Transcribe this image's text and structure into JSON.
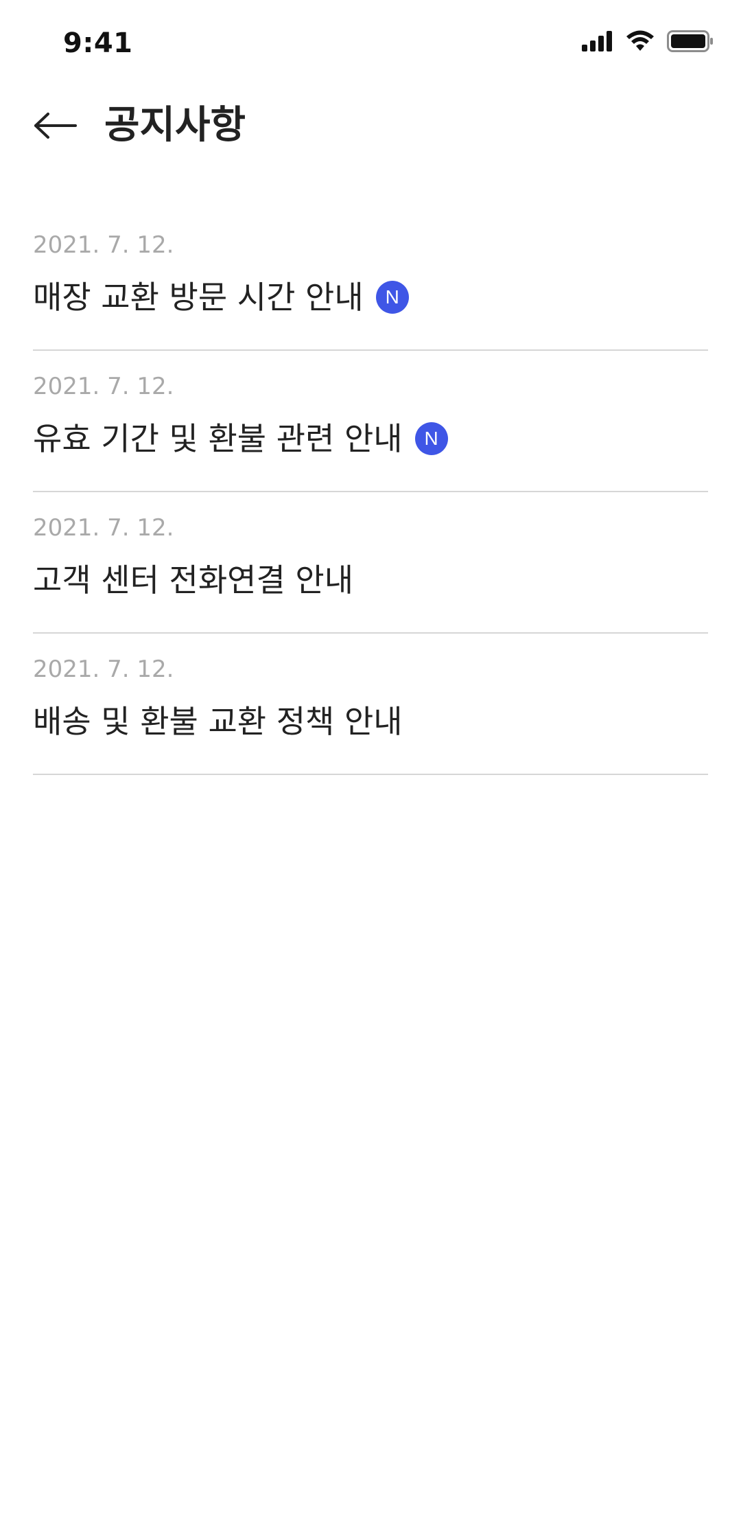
{
  "status_bar": {
    "time": "9:41",
    "icons": [
      "signal-icon",
      "wifi-icon",
      "battery-icon"
    ]
  },
  "header": {
    "back_icon": "back-arrow-icon",
    "title": "공지사항"
  },
  "notices": [
    {
      "date": "2021. 7. 12.",
      "title": "매장 교환 방문 시간 안내",
      "badge": "N"
    },
    {
      "date": "2021. 7. 12.",
      "title": "유효 기간 및 환불 관련 안내",
      "badge": "N"
    },
    {
      "date": "2021. 7. 12.",
      "title": "고객 센터 전화연결 안내",
      "badge": null
    },
    {
      "date": "2021. 7. 12.",
      "title": "배송 및 환불 교환 정책 안내",
      "badge": null
    }
  ],
  "colors": {
    "badge_background": "#3f56e6",
    "date_text": "#a9a9a9",
    "divider": "#d6d6d6"
  }
}
